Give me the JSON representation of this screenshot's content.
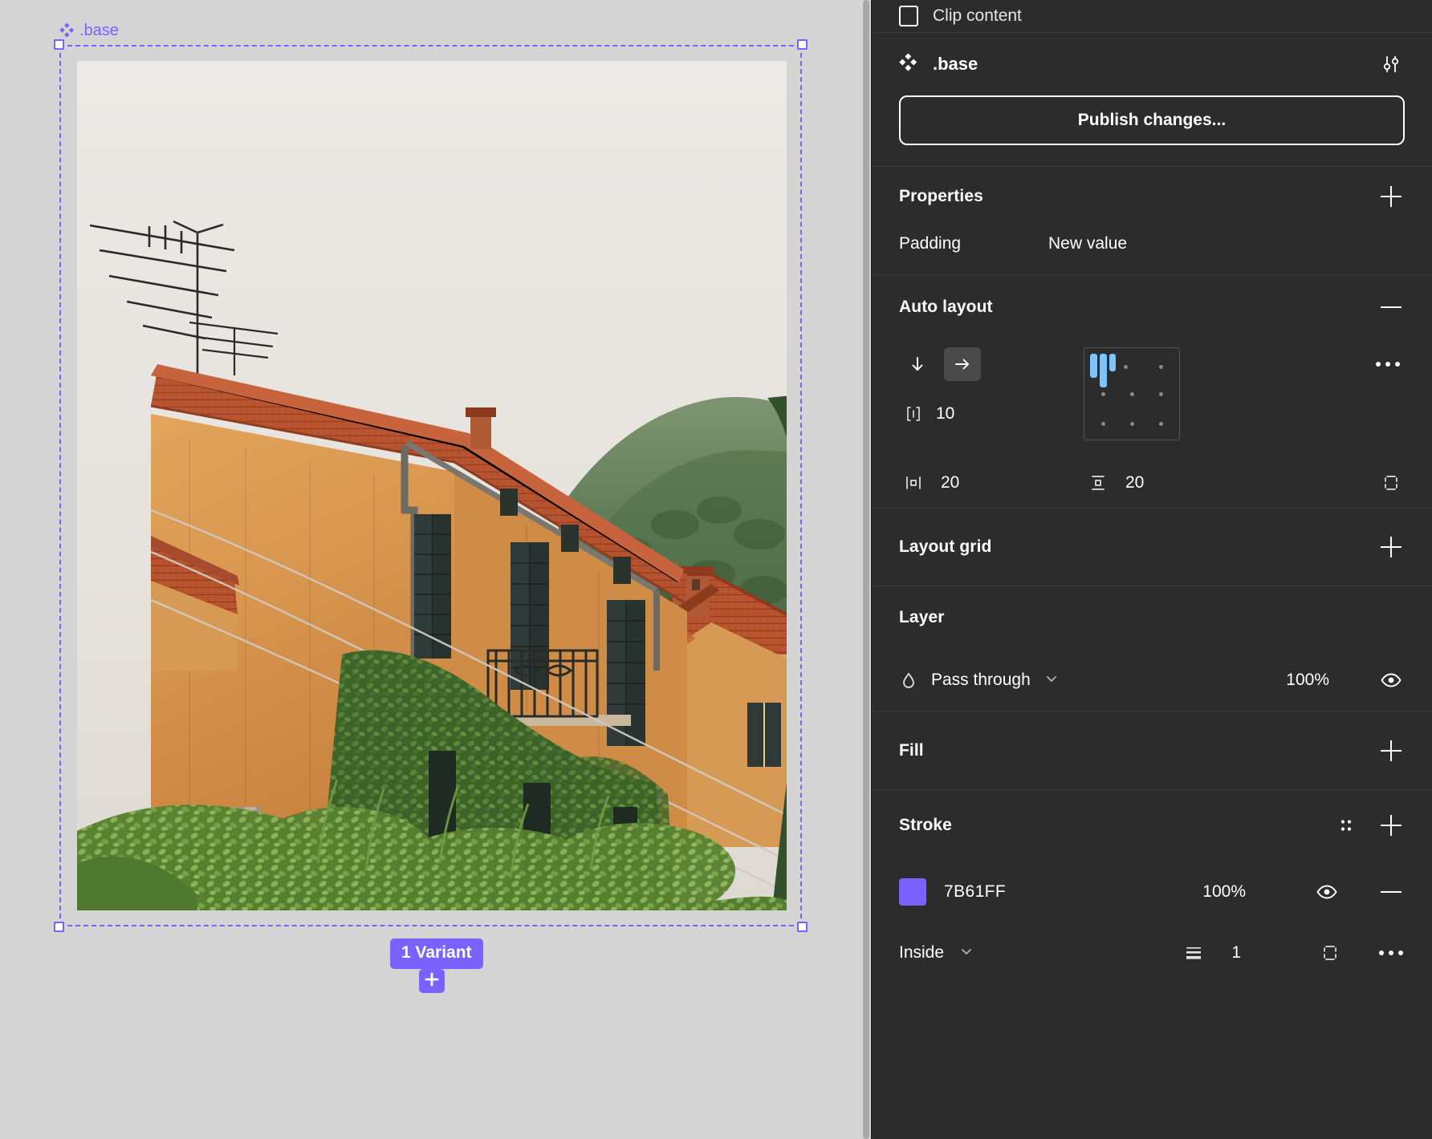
{
  "canvas": {
    "frame_label": ".base",
    "frame_icon": "component-diamond-icon",
    "variant_badge": "1 Variant",
    "add_variant_icon": "plus-icon",
    "selection_color": "#7B61FF",
    "background": "#d4d4d4",
    "photo_alt": "ochre-italian-villa-with-ivy"
  },
  "panel": {
    "clip_content": {
      "label": "Clip content",
      "checked": false
    },
    "component": {
      "name": ".base",
      "icon": "component-diamond-icon",
      "settings_icon": "sliders-icon",
      "publish_label": "Publish changes..."
    },
    "properties": {
      "title": "Properties",
      "add_icon": "plus-icon",
      "rows": [
        {
          "key": "Padding",
          "value": "New value"
        }
      ]
    },
    "auto_layout": {
      "title": "Auto layout",
      "collapse_icon": "minus-icon",
      "direction_vertical_icon": "arrow-down-icon",
      "direction_horizontal_icon": "arrow-right-icon",
      "direction_selected": "horizontal",
      "gap_icon": "spacing-horizontal-icon",
      "gap": "10",
      "padding_horizontal_icon": "padding-horizontal-icon",
      "padding_horizontal": "20",
      "padding_vertical_icon": "padding-vertical-icon",
      "padding_vertical": "20",
      "individual_padding_icon": "individual-padding-icon",
      "more_icon": "more-horizontal-icon",
      "alignment": "top-left"
    },
    "layout_grid": {
      "title": "Layout grid",
      "add_icon": "plus-icon"
    },
    "layer": {
      "title": "Layer",
      "blend_icon": "blend-drop-icon",
      "blend_mode": "Pass through",
      "chevron_icon": "chevron-down-icon",
      "opacity": "100%",
      "visibility_icon": "eye-icon"
    },
    "fill": {
      "title": "Fill",
      "add_icon": "plus-icon"
    },
    "stroke": {
      "title": "Stroke",
      "style_icon": "stroke-style-icon",
      "add_icon": "plus-icon",
      "color_hex": "7B61FF",
      "color_value": "#7B61FF",
      "opacity": "100%",
      "visibility_icon": "eye-icon",
      "remove_icon": "minus-icon",
      "position": "Inside",
      "position_chevron_icon": "chevron-down-icon",
      "weight_icon": "stroke-weight-icon",
      "weight": "1",
      "advanced_icon": "stroke-sides-icon",
      "more_icon": "more-horizontal-icon"
    }
  }
}
